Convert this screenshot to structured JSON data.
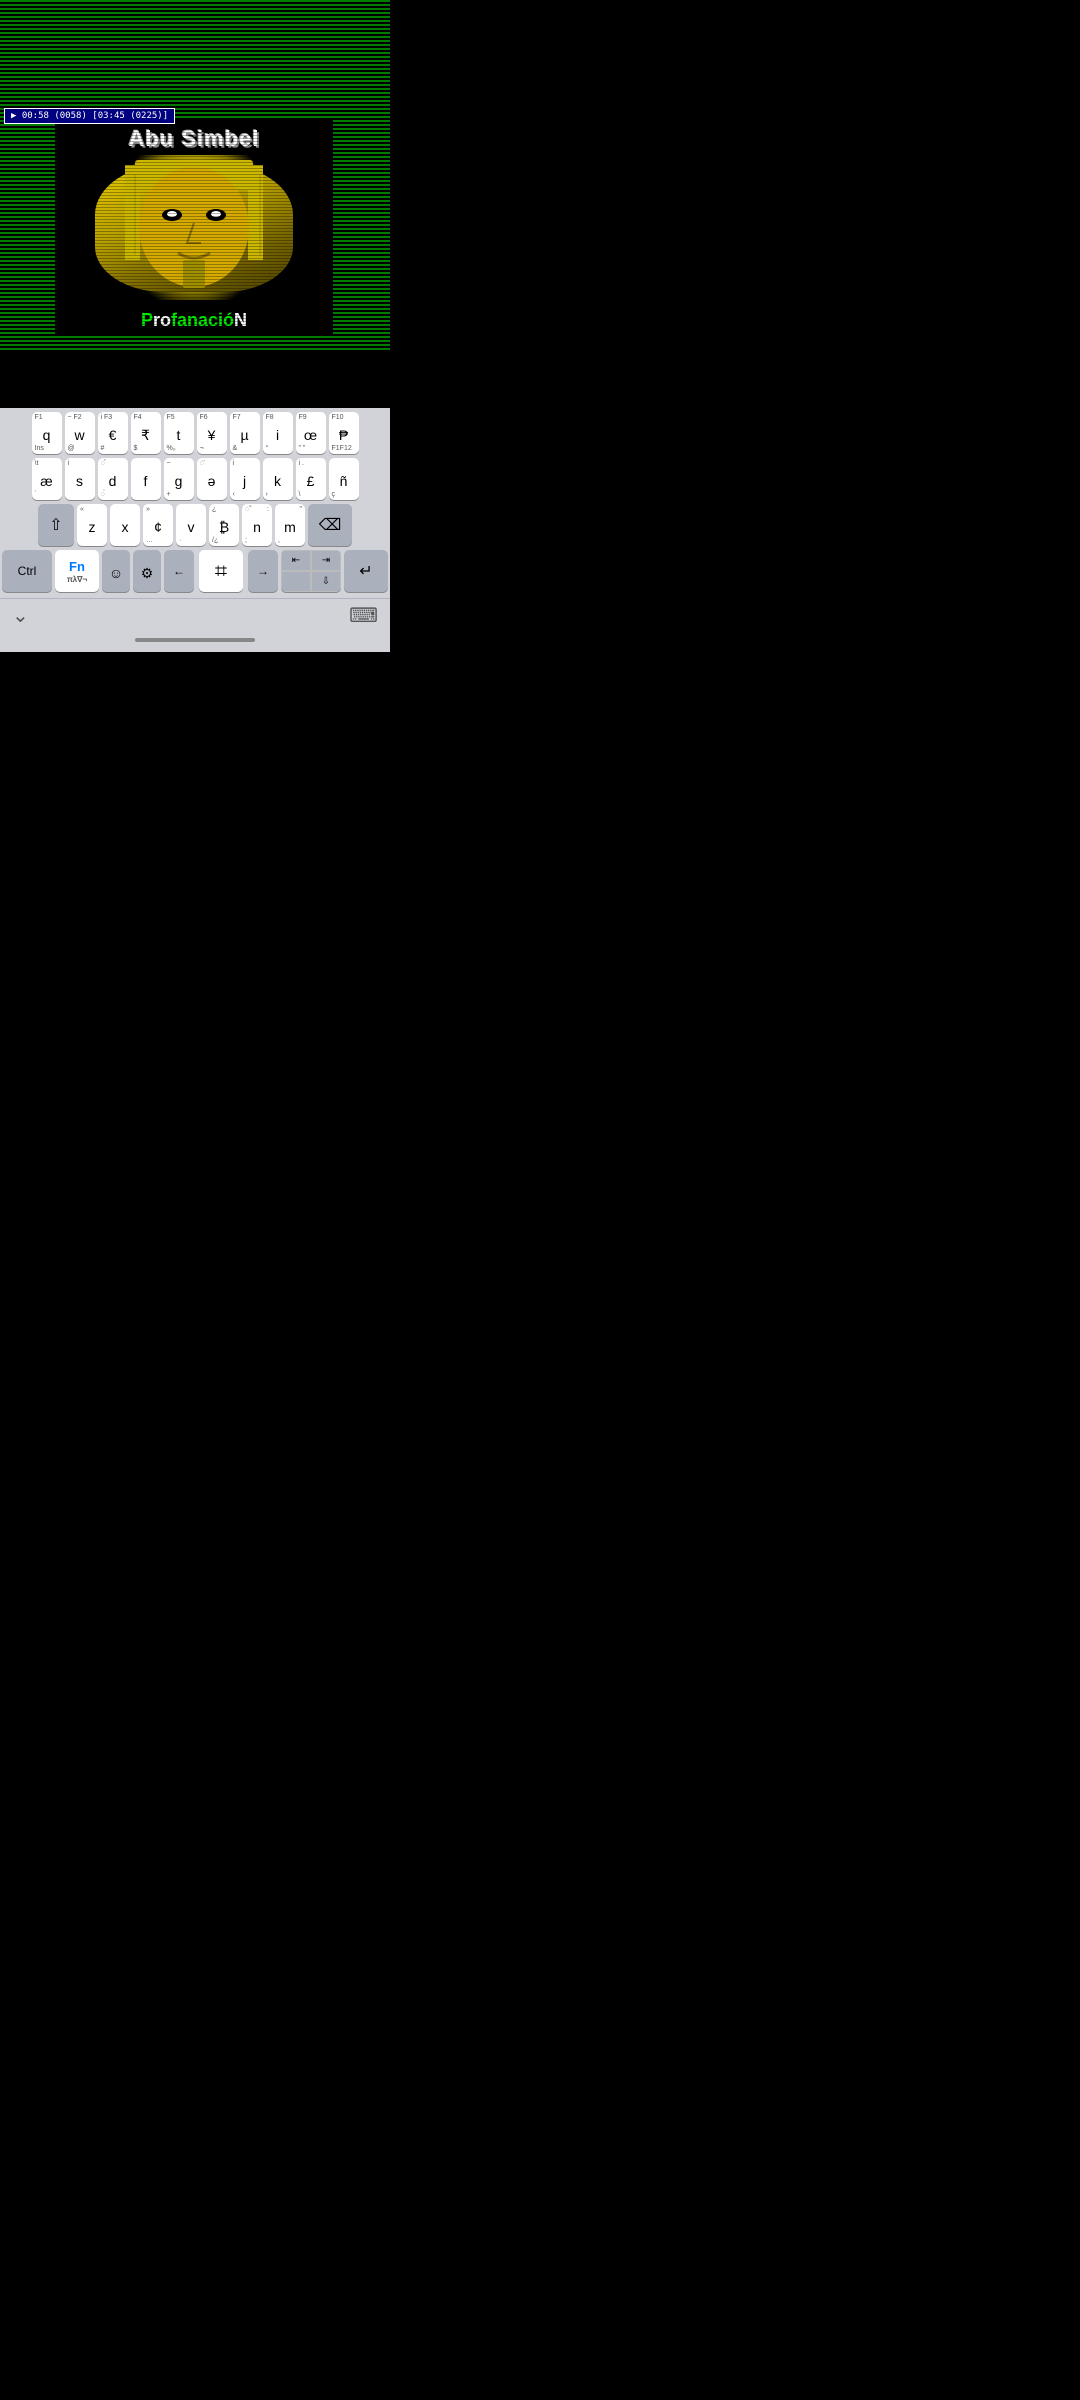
{
  "emulator": {
    "status": "▶ 00:58 (0058) [03:45 (0225)]",
    "game_title": "Abu Simbel",
    "game_subtitle_prefix": "Pro",
    "game_subtitle_middle": "fanaci",
    "game_subtitle_suffix": "N"
  },
  "keyboard": {
    "row1": [
      {
        "top": "F1",
        "main": "q",
        "bottom": "Ins"
      },
      {
        "top": "~ F2",
        "main": "w",
        "bottom": "@"
      },
      {
        "top": "i F3",
        "main": "€",
        "bottom": "#"
      },
      {
        "top": "F4",
        "main": "₹",
        "bottom": "$"
      },
      {
        "top": "F5",
        "main": "t",
        "bottom": "%₀"
      },
      {
        "top": "F6",
        "main": "¥",
        "bottom": "¬"
      },
      {
        "top": "F7",
        "main": "µ",
        "bottom": "&"
      },
      {
        "top": "F8",
        "main": "i",
        "bottom": "°"
      },
      {
        "top": "F9",
        "main": "œ",
        "bottom": "\" \""
      },
      {
        "top": "F10",
        "main": "₱",
        "bottom": "F1F12"
      }
    ],
    "row2": [
      {
        "top": "\\t",
        "main": "æ",
        "bottom": "`"
      },
      {
        "top": "i",
        "main": "s",
        "bottom": ""
      },
      {
        "top": "",
        "main": "d",
        "bottom": "◌́"
      },
      {
        "top": "",
        "main": "f",
        "bottom": ""
      },
      {
        "top": "−",
        "main": "g",
        "bottom": "+"
      },
      {
        "top": "≈",
        "main": "ə",
        "bottom": ""
      },
      {
        "top": "i",
        "main": "j",
        "bottom": "‹"
      },
      {
        "top": "",
        "main": "k",
        "bottom": "›"
      },
      {
        "top": "i .",
        "main": "£",
        "bottom": "\\"
      },
      {
        "top": "",
        "main": "ñ",
        "bottom": "ç"
      }
    ],
    "row3_special": {
      "shift_label": "⇧",
      "keys": [
        {
          "top": "«",
          "main": "z",
          "bottom": ""
        },
        {
          "top": "",
          "main": "x",
          "bottom": ""
        },
        {
          "top": "»",
          "main": "¢",
          "bottom": "…"
        },
        {
          "top": "",
          "main": "v",
          "bottom": "·"
        },
        {
          "top": "¿",
          "main": "₿",
          "bottom": "/¿"
        },
        {
          "top": "◌̃",
          "main": "n",
          "bottom": ";"
        },
        {
          "top": ":",
          "main": "m",
          "bottom": ","
        }
      ],
      "backspace": "⌫"
    },
    "row4": {
      "ctrl": "Ctrl",
      "fn": "Fn",
      "fn_bottom": "πλ∇¬",
      "emoji": "☺",
      "settings": "⚙",
      "left_arrow": "←",
      "space_char": "⌗",
      "right_arrow": "→",
      "nav_tl": "⇤",
      "nav_tr": "⇥",
      "nav_bl": "",
      "nav_br": "⇩",
      "return": "↵"
    },
    "bottom_bar": {
      "hide_keyboard": "⌄",
      "keyboard_switch": "⌨"
    }
  }
}
